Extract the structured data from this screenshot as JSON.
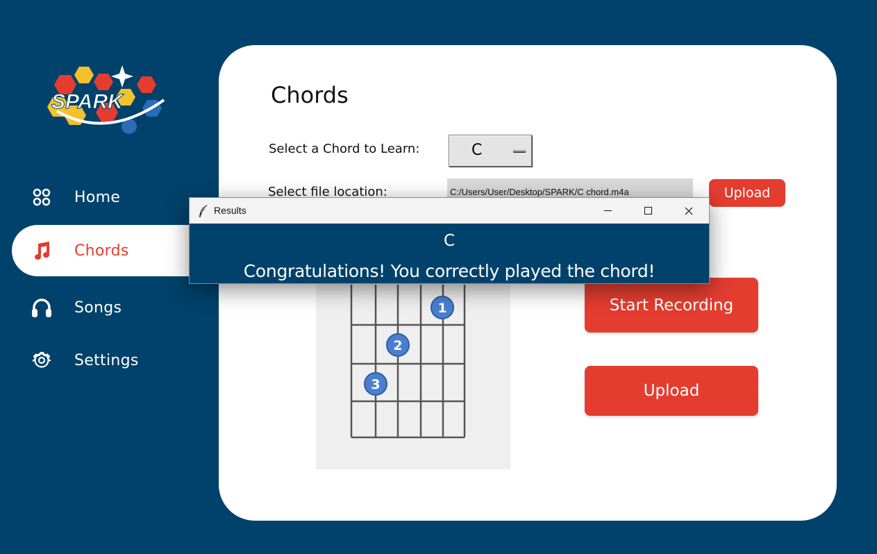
{
  "app": {
    "logo_text": "SPARK"
  },
  "sidebar": {
    "items": [
      {
        "label": "Home",
        "icon": "grid-icon"
      },
      {
        "label": "Chords",
        "icon": "music-note-icon",
        "active": true
      },
      {
        "label": "Songs",
        "icon": "headphones-icon"
      },
      {
        "label": "Settings",
        "icon": "gear-icon"
      }
    ]
  },
  "main": {
    "title": "Chords",
    "select_label": "Select a Chord to Learn:",
    "selected_chord": "C",
    "file_label": "Select file location:",
    "file_path": "C:/Users/User/Desktop/SPARK/C chord.m4a",
    "upload_small_label": "Upload",
    "start_recording_label": "Start Recording",
    "upload_label": "Upload",
    "chord_diagram": {
      "fingers": [
        "1",
        "2",
        "3"
      ]
    }
  },
  "dialog": {
    "title": "Results",
    "chord": "C",
    "message": "Congratulations! You correctly played the chord!"
  },
  "colors": {
    "background": "#00426b",
    "accent": "#e43d30",
    "finger_dot": "#4a7fd0"
  }
}
